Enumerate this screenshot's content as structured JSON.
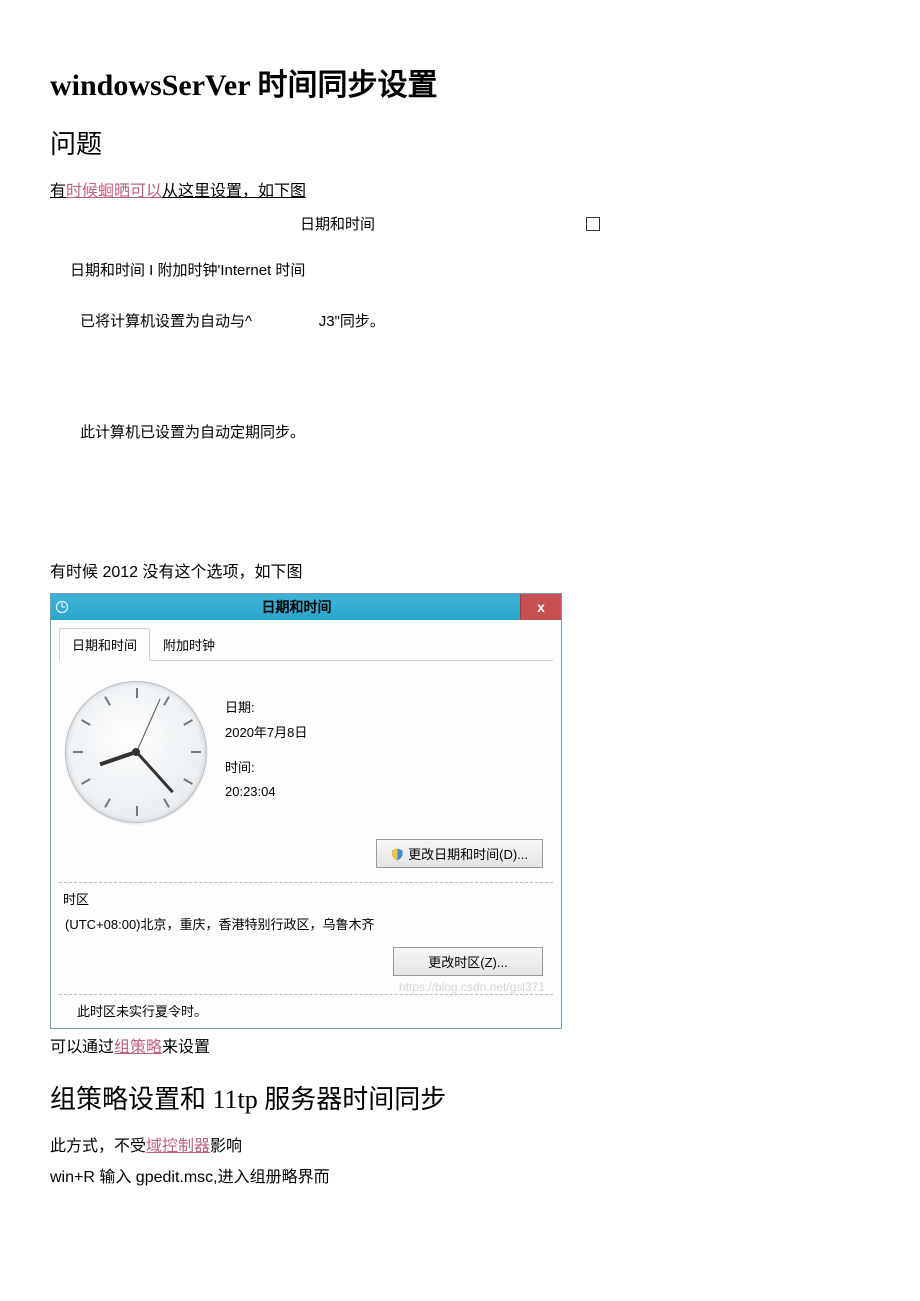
{
  "title": "windowsSerVer 时间同步设置",
  "section_problem": "问题",
  "para1_prefix": "有",
  "para1_link": "时候蛔晒可以",
  "para1_suffix": "从这里设置，如下图",
  "dialog1": {
    "title": "日期和时间",
    "tabs": "日期和时间 I 附加时钟'Internet 时间",
    "status1_a": "已将计算机设置为自动与^",
    "status1_b": "J3\"同步。",
    "status2": "此计算机已设置为自动定期同步。"
  },
  "para2": "有时候 2012 没有这个选项，如下图",
  "dialog2": {
    "title": "日期和时间",
    "close": "x",
    "tab1": "日期和时间",
    "tab2": "附加时钟",
    "date_label": "日期:",
    "date_value": "2020年7月8日",
    "time_label": "时间:",
    "time_value": "20:23:04",
    "change_datetime": "更改日期和时间(D)...",
    "timezone_label": "时区",
    "timezone_value": "(UTC+08:00)北京，重庆，香港特别行政区，乌鲁木齐",
    "change_timezone": "更改时区(Z)...",
    "watermark": "https://blog.csdn.net/gsl371",
    "dst": "此时区未实行夏令时。"
  },
  "para3_a": "可以通过",
  "para3_link": "组策略",
  "para3_b": "来设置",
  "section_gpo": "组策略设置和 11tp 服务器时间同步",
  "para4_a": "此方式，不受",
  "para4_link": "域控制器",
  "para4_b": "影响",
  "para5": "win+R 输入 gpedit.msc,进入组册略界而"
}
